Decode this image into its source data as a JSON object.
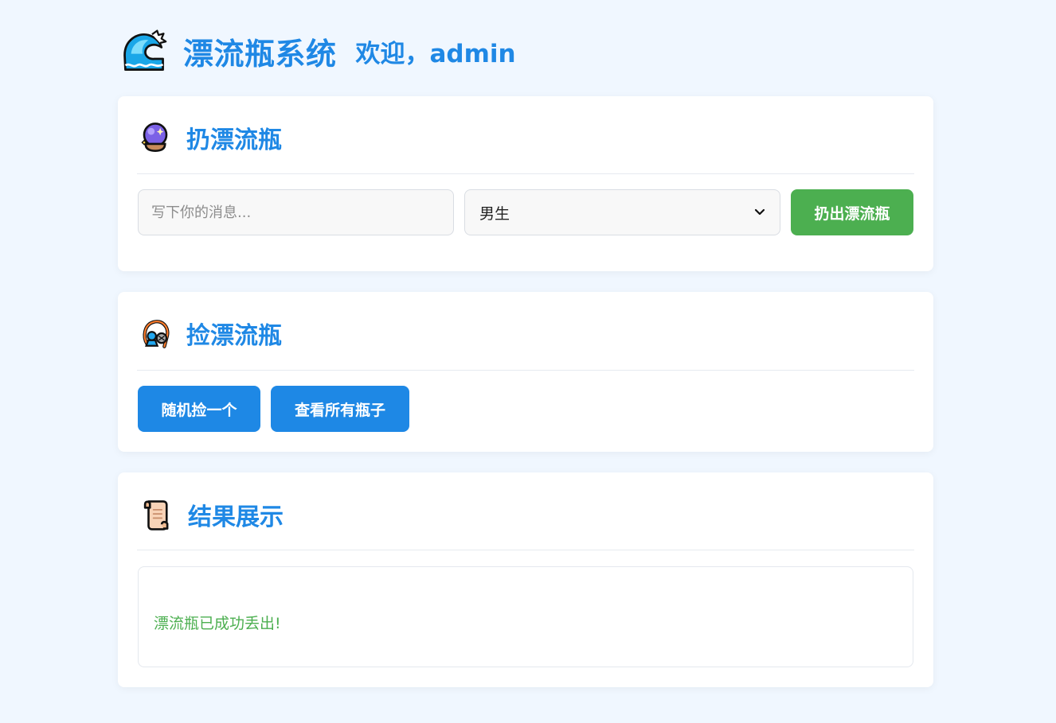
{
  "header": {
    "title": "漂流瓶系统",
    "welcome": "欢迎，admin"
  },
  "throw_section": {
    "heading": "扔漂流瓶",
    "icon": "crystal-ball-icon",
    "message_placeholder": "写下你的消息...",
    "message_value": "",
    "gender_selected": "男生",
    "throw_button": "扔出漂流瓶"
  },
  "pick_section": {
    "heading": "捡漂流瓶",
    "icon": "fishing-net-icon",
    "random_button": "随机捡一个",
    "view_all_button": "查看所有瓶子"
  },
  "result_section": {
    "heading": "结果展示",
    "icon": "scroll-icon",
    "message": "漂流瓶已成功丢出!"
  },
  "colors": {
    "primary": "#1e88e5",
    "success": "#4caf50",
    "background": "#f0f7ff"
  }
}
